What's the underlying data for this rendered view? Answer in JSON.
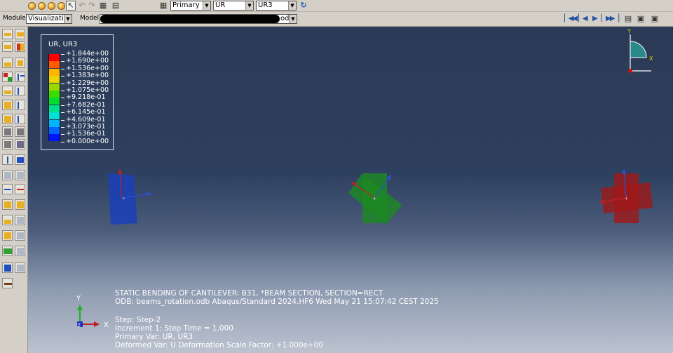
{
  "toolbar": {
    "primary_label": "Primary",
    "var_label": "UR",
    "component_label": "UR3"
  },
  "module_bar": {
    "module_caption": "Module:",
    "module_value": "Visualization",
    "model_caption": "Model:",
    "model_value_suffix": "odb"
  },
  "legend": {
    "title": "UR, UR3",
    "values": [
      "+1.844e+00",
      "+1.690e+00",
      "+1.536e+00",
      "+1.383e+00",
      "+1.229e+00",
      "+1.075e+00",
      "+9.218e-01",
      "+7.682e-01",
      "+6.145e-01",
      "+4.609e-01",
      "+3.073e-01",
      "+1.536e-01",
      "+0.000e+00"
    ],
    "colors": [
      "#ff0000",
      "#ff5a00",
      "#ffb400",
      "#e6d800",
      "#9bd800",
      "#3cdc00",
      "#00dc30",
      "#00e08c",
      "#00e0d4",
      "#00b4ff",
      "#0064ff",
      "#0014ff"
    ]
  },
  "info": {
    "line1": "STATIC BENDING OF CANTILEVER: B31, *BEAM SECTION, SECTION=RECT",
    "line2": "ODB: beams_rotation.odb    Abaqus/Standard 2024.HF6    Wed May 21 15:07:42 CEST 2025",
    "line3": "Step: Step-2",
    "line4": "Increment      1: Step Time =     1.000",
    "line5": "Primary Var: UR, UR3",
    "line6": "Deformed Var: U   Deformation Scale Factor: +1.000e+00"
  },
  "triad": {
    "y_label": "Y",
    "x_label": "X",
    "z_label": "Z"
  },
  "view_triad": {
    "y_label": "Y",
    "x_label": "X"
  },
  "shapes": {
    "colors": {
      "blue": "#1a40b8",
      "green": "#1c8a22",
      "red": "#a01818"
    }
  }
}
